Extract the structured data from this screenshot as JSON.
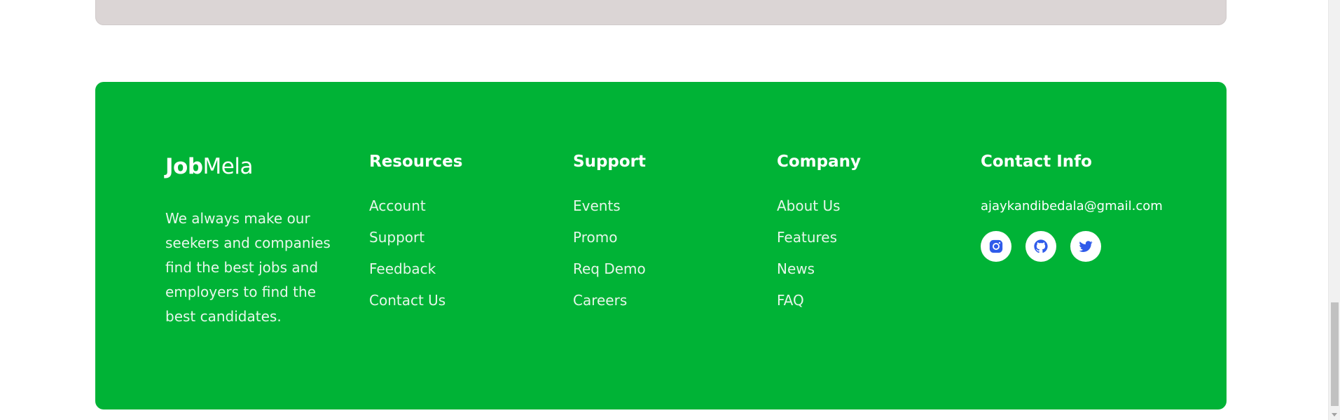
{
  "footer": {
    "brand": {
      "bold": "Job",
      "light": "Mela"
    },
    "description": "We always make our seekers and companies find the best jobs and employers to find the best candidates.",
    "resources": {
      "heading": "Resources",
      "links": [
        "Account",
        "Support",
        "Feedback",
        "Contact Us"
      ]
    },
    "support": {
      "heading": "Support",
      "links": [
        "Events",
        "Promo",
        "Req Demo",
        "Careers"
      ]
    },
    "company": {
      "heading": "Company",
      "links": [
        "About Us",
        "Features",
        "News",
        "FAQ"
      ]
    },
    "contact": {
      "heading": "Contact Info",
      "email": "ajaykandibedala@gmail.com",
      "socials": [
        "instagram-icon",
        "github-icon",
        "twitter-icon"
      ]
    }
  },
  "colors": {
    "footer_bg": "#00b336",
    "top_card_bg": "#dbd5d5",
    "social_icon": "#2f5bea"
  }
}
